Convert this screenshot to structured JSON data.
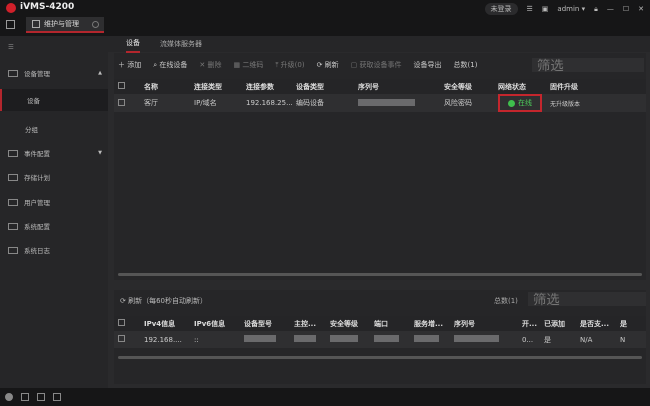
{
  "app": {
    "title": "iVMS-4200",
    "tab": "维护与管理",
    "cloud": "未登录",
    "user": "admin"
  },
  "sidebar": {
    "items": [
      {
        "label": "设备管理"
      },
      {
        "label": "设备"
      },
      {
        "label": "分组"
      },
      {
        "label": "事件配置"
      },
      {
        "label": "存储计划"
      },
      {
        "label": "用户管理"
      },
      {
        "label": "系统配置"
      },
      {
        "label": "系统日志"
      }
    ]
  },
  "subtabs": [
    "设备",
    "流媒体服务器"
  ],
  "toolbar": {
    "add": "添加",
    "online": "在线设备",
    "delete": "删除",
    "qrcode": "二维码",
    "upgrade": "升级(0)",
    "refresh": "刷新",
    "events": "获取设备事件",
    "export": "设备导出",
    "total": "总数(1)",
    "filter": "筛选"
  },
  "devices": {
    "headers": [
      "名称",
      "连接类型",
      "连接参数",
      "设备类型",
      "序列号",
      "安全等级",
      "网络状态",
      "固件升级"
    ],
    "rows": [
      {
        "name": "客厅",
        "conn": "IP/域名",
        "param": "192.168.25....",
        "type": "编码设备",
        "level": "风险密码",
        "status": "在线",
        "fw": "无升级版本"
      }
    ]
  },
  "online": {
    "refresh": "刷新（每60秒自动刷新）",
    "total": "总数(1)",
    "filter": "筛选",
    "headers": [
      "IPv4信息",
      "IPv6信息",
      "设备型号",
      "主控...",
      "安全等级",
      "端口",
      "服务增...",
      "序列号",
      "开...",
      "已添加",
      "是否支...",
      "是"
    ],
    "rows": [
      {
        "ipv4": "192.168....",
        "ipv6": "::",
        "open": "0...",
        "added": "是",
        "support": "N/A",
        "last": "N"
      }
    ]
  }
}
